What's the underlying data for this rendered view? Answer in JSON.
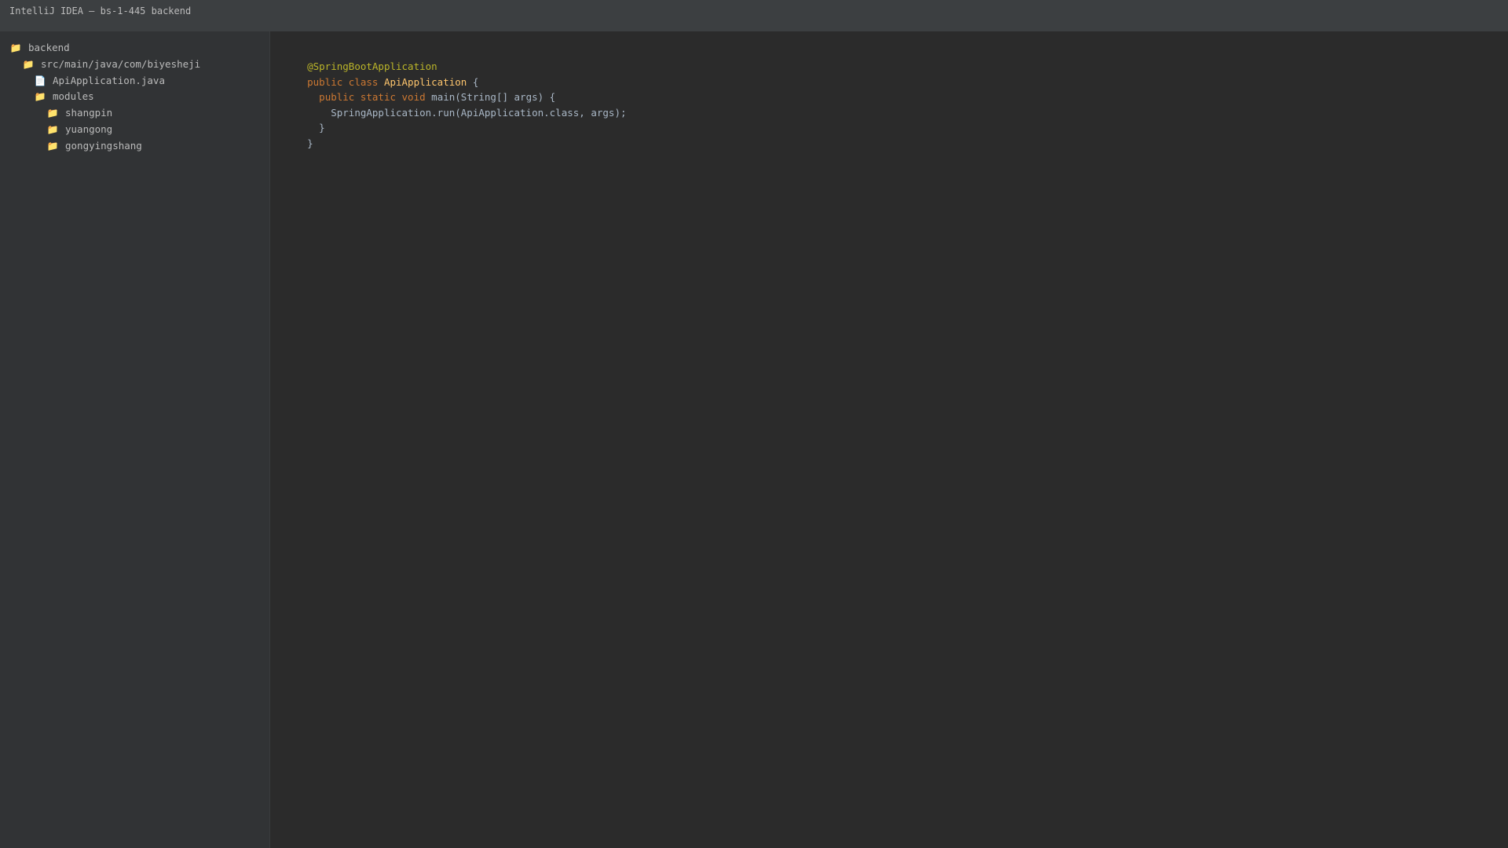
{
  "window": {
    "title": "IntelliJ IDEA — bs-1-445 backend"
  },
  "project_tree": {
    "items": [
      {
        "label": "backend",
        "icon": "folder-icon"
      },
      {
        "label": "src/main/java/com/biyesheji",
        "icon": "folder-icon"
      },
      {
        "label": "ApiApplication.java",
        "icon": "file-icon"
      },
      {
        "label": "modules",
        "icon": "folder-icon"
      },
      {
        "label": "shangpin",
        "icon": "folder-icon"
      },
      {
        "label": "yuangong",
        "icon": "folder-icon"
      },
      {
        "label": "gongyingshang",
        "icon": "folder-icon"
      }
    ]
  },
  "editor": {
    "line1": {
      "annotation": "@SpringBootApplication"
    },
    "line2": {
      "kw": "public class ",
      "cls": "ApiApplication",
      "rest": " {"
    },
    "line3": {
      "indent": "  ",
      "kw": "public static void ",
      "rest": "main(String[] args) {"
    },
    "line4": {
      "text": "    SpringApplication.run(ApiApplication.class, args);"
    },
    "line5": {
      "text": "  }"
    },
    "line6": {
      "text": "}"
    }
  },
  "colors": {
    "titlebar_bg": "#3c3f41",
    "sidebar_bg": "#313335",
    "editor_bg": "#2b2b2b",
    "keyword": "#cc7832",
    "annotation": "#bbb529",
    "class_name": "#ffc66d",
    "folder_icon": "#e8b84a"
  }
}
